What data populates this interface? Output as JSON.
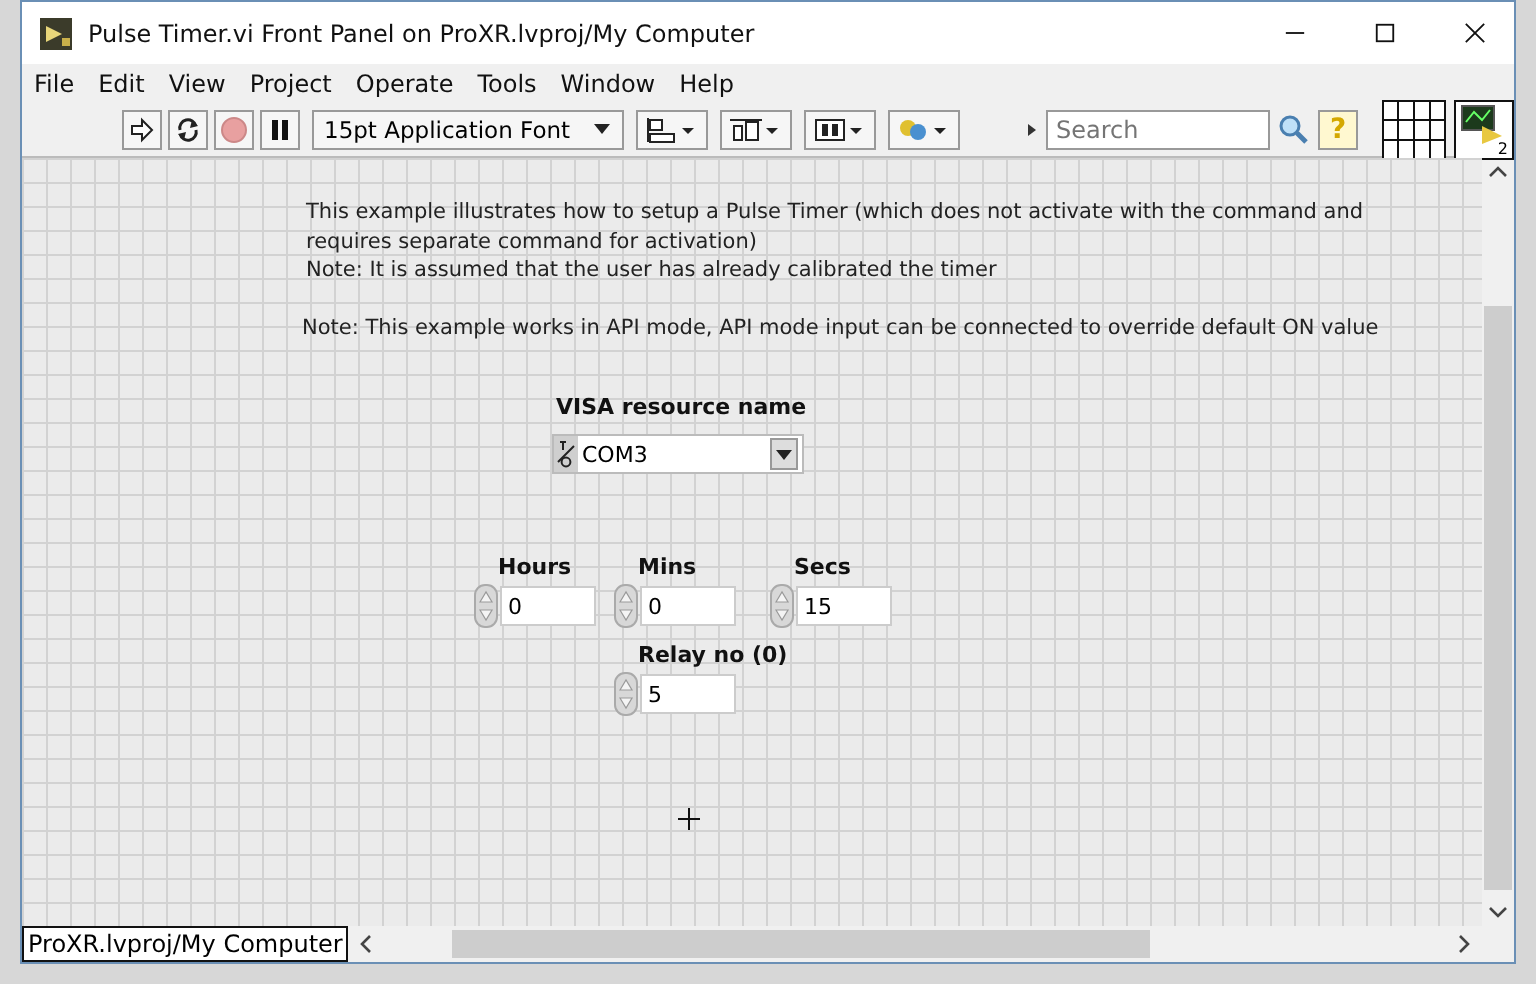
{
  "window": {
    "title": "Pulse Timer.vi Front Panel on ProXR.lvproj/My Computer"
  },
  "menu": [
    "File",
    "Edit",
    "View",
    "Project",
    "Operate",
    "Tools",
    "Window",
    "Help"
  ],
  "toolbar": {
    "font": "15pt Application Font",
    "search": {
      "placeholder": "Search"
    },
    "help": "?",
    "vi_icon_badge": "2"
  },
  "notes": [
    "This example illustrates how to setup a Pulse Timer (which does not activate with the command and requires separate command for activation)",
    "Note: It is assumed that the user has already calibrated the timer",
    "Note: This example works in API mode, API mode input can be connected to override default ON value"
  ],
  "visa": {
    "label": "VISA resource name",
    "value": "COM3"
  },
  "numerics": [
    {
      "label": "Hours",
      "value": "0"
    },
    {
      "label": "Mins",
      "value": "0"
    },
    {
      "label": "Secs",
      "value": "15"
    },
    {
      "label": "Relay no (0)",
      "value": "5"
    }
  ],
  "status_bar": {
    "path": "ProXR.lvproj/My Computer"
  }
}
